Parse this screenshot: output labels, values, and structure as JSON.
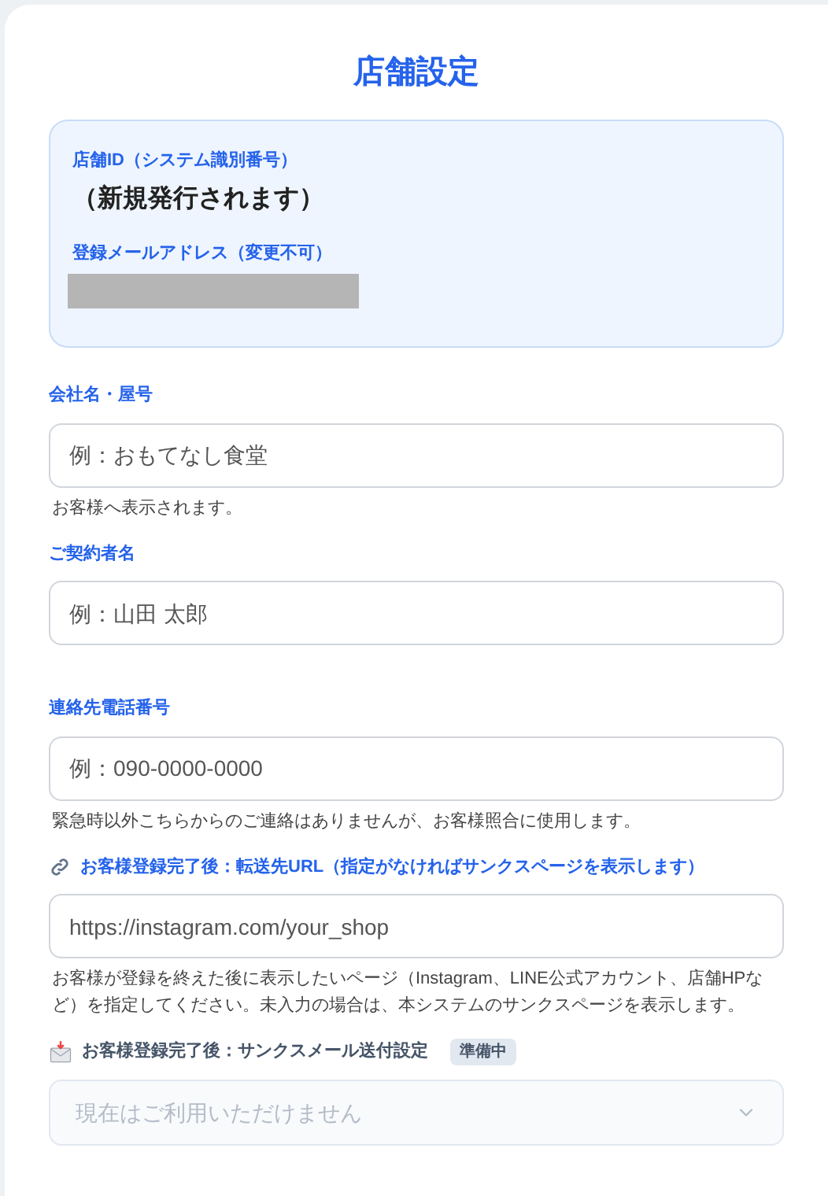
{
  "title": "店舗設定",
  "info_box": {
    "id_label": "店舗ID（システム識別番号）",
    "id_value": "（新規発行されます）",
    "email_label": "登録メールアドレス（変更不可）",
    "email_redacted": true
  },
  "fields": [
    {
      "kind": "input",
      "label": "会社名・屋号",
      "placeholder": "例：おもてなし食堂",
      "help": "お客様へ表示されます。"
    },
    {
      "kind": "input",
      "label": "ご契約者名",
      "placeholder": "例：山田 太郎"
    },
    {
      "kind": "input",
      "label": "連絡先電話番号",
      "placeholder": "例：090-0000-0000",
      "help": "緊急時以外こちらからのご連絡はありませんが、お客様照合に使用します。"
    },
    {
      "kind": "url",
      "label": "お客様登録完了後：転送先URL（指定がなければサンクスページを表示します）",
      "placeholder": "https://instagram.com/your_shop",
      "help": "お客様が登録を終えた後に表示したいページ（Instagram、LINE公式アカウント、店舗HPなど）を指定してください。未入力の場合は、本システムのサンクスページを表示します。"
    },
    {
      "kind": "select",
      "label": "お客様登録完了後：サンクスメール送付設定",
      "badge": "準備中",
      "value": "現在はご利用いただけません",
      "disabled": true
    }
  ]
}
